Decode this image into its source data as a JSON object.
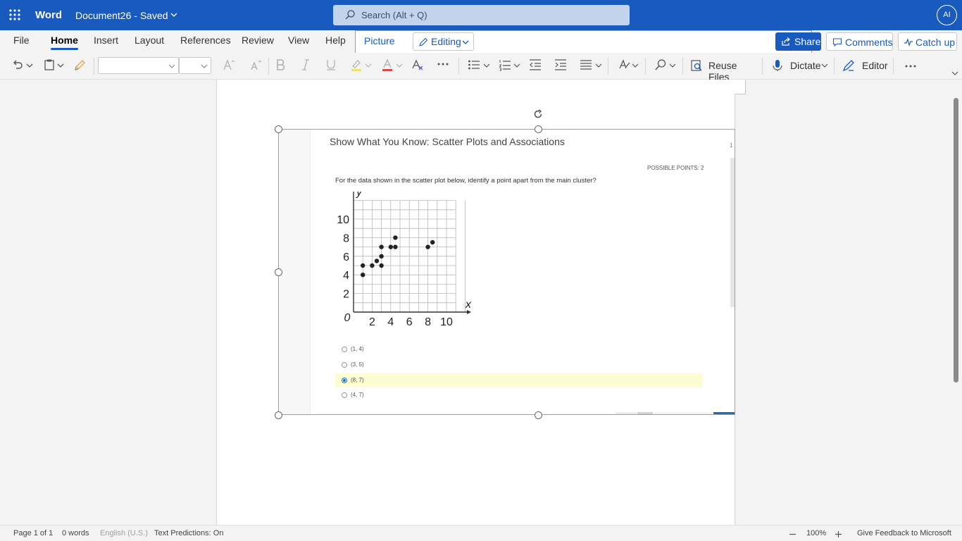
{
  "app": {
    "name": "Word",
    "doc_title": "Document26",
    "separator": " - ",
    "save_state": "Saved",
    "avatar_initials": "AI"
  },
  "search": {
    "placeholder": "Search (Alt + Q)"
  },
  "tabs": [
    {
      "label": "File"
    },
    {
      "label": "Home"
    },
    {
      "label": "Insert"
    },
    {
      "label": "Layout"
    },
    {
      "label": "References"
    },
    {
      "label": "Review"
    },
    {
      "label": "View"
    },
    {
      "label": "Help"
    },
    {
      "label": "Picture"
    }
  ],
  "mode": {
    "label": "Editing"
  },
  "actions": {
    "share": "Share",
    "comments": "Comments",
    "catch_up": "Catch up"
  },
  "ribbon": {
    "reuse_files": "Reuse Files",
    "dictate": "Dictate",
    "editor": "Editor"
  },
  "question": {
    "title": "Show What You Know: Scatter Plots and Associations",
    "points": "POSSIBLE POINTS: 2",
    "text": "For the data shown in the scatter plot below, identify a point apart from the main cluster?",
    "page_marker": "1",
    "options": [
      {
        "label": "(1, 4)",
        "selected": false
      },
      {
        "label": "(3, 5)",
        "selected": false
      },
      {
        "label": "(8, 7)",
        "selected": true
      },
      {
        "label": "(4, 7)",
        "selected": false
      }
    ],
    "plot": {
      "x_label": "x",
      "y_label": "y",
      "origin_label": "0",
      "x_ticks": [
        "2",
        "4",
        "6",
        "8",
        "10"
      ],
      "y_ticks": [
        "2",
        "4",
        "6",
        "8",
        "10"
      ],
      "points": [
        [
          1,
          4
        ],
        [
          1,
          5
        ],
        [
          2,
          5
        ],
        [
          2.5,
          5.5
        ],
        [
          3,
          5
        ],
        [
          3,
          6
        ],
        [
          3,
          7
        ],
        [
          4,
          7
        ],
        [
          4.5,
          7
        ],
        [
          4.5,
          8
        ],
        [
          8,
          7
        ],
        [
          8.5,
          7.5
        ]
      ]
    }
  },
  "status": {
    "page": "Page 1 of 1",
    "words": "0 words",
    "language": "English (U.S.)",
    "predictions": "Text Predictions: On",
    "zoom": "100%",
    "feedback": "Give Feedback to Microsoft"
  },
  "colors": {
    "brand": "#185abd",
    "selected_option": "#fdfbd2"
  }
}
